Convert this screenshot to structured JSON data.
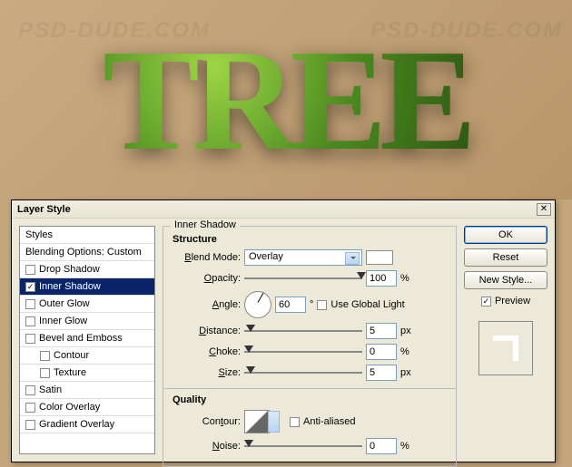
{
  "canvas": {
    "text": "TREE"
  },
  "dialog": {
    "title": "Layer Style",
    "sidebar": {
      "styles": "Styles",
      "blending": "Blending Options: Custom",
      "items": [
        {
          "label": "Drop Shadow",
          "checked": false,
          "selected": false
        },
        {
          "label": "Inner Shadow",
          "checked": true,
          "selected": true
        },
        {
          "label": "Outer Glow",
          "checked": false,
          "selected": false
        },
        {
          "label": "Inner Glow",
          "checked": false,
          "selected": false
        },
        {
          "label": "Bevel and Emboss",
          "checked": false,
          "selected": false
        },
        {
          "label": "Contour",
          "checked": false,
          "selected": false,
          "indent": true
        },
        {
          "label": "Texture",
          "checked": false,
          "selected": false,
          "indent": true
        },
        {
          "label": "Satin",
          "checked": false,
          "selected": false
        },
        {
          "label": "Color Overlay",
          "checked": false,
          "selected": false
        },
        {
          "label": "Gradient Overlay",
          "checked": false,
          "selected": false
        }
      ]
    },
    "panel": {
      "title": "Inner Shadow",
      "structure": {
        "heading": "Structure",
        "blend_mode_label": "Blend Mode:",
        "blend_mode": "Overlay",
        "opacity_label": "Opacity:",
        "opacity": "100",
        "opacity_unit": "%",
        "angle_label": "Angle:",
        "angle": "60",
        "angle_unit": "°",
        "global_light_label": "Use Global Light",
        "global_light": false,
        "distance_label": "Distance:",
        "distance": "5",
        "distance_unit": "px",
        "choke_label": "Choke:",
        "choke": "0",
        "choke_unit": "%",
        "size_label": "Size:",
        "size": "5",
        "size_unit": "px"
      },
      "quality": {
        "heading": "Quality",
        "contour_label": "Contour:",
        "antialiased_label": "Anti-aliased",
        "antialiased": false,
        "noise_label": "Noise:",
        "noise": "0",
        "noise_unit": "%"
      }
    },
    "buttons": {
      "ok": "OK",
      "reset": "Reset",
      "new_style": "New Style...",
      "preview_label": "Preview",
      "preview": true
    }
  }
}
